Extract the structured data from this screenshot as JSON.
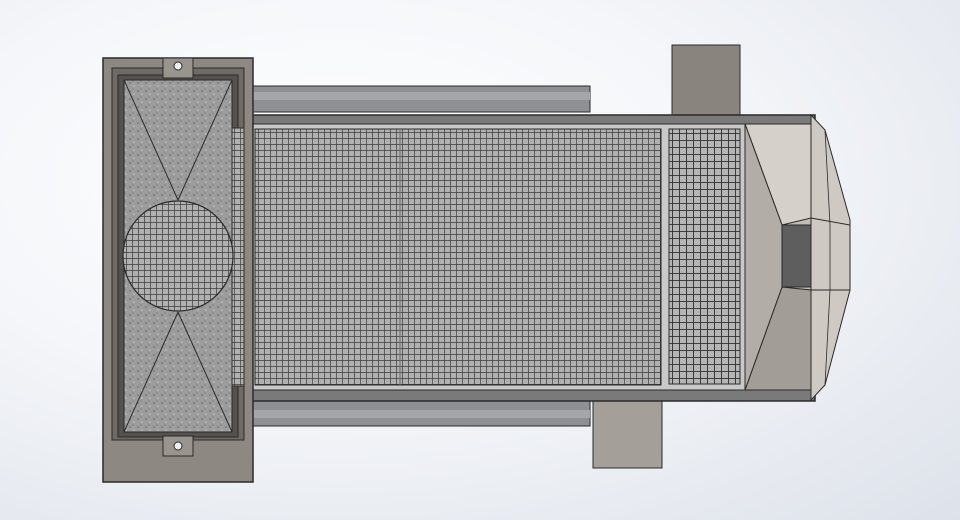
{
  "colors": {
    "frame": "#8d8882",
    "frame_inner": "#6f6a66",
    "filter": "#9a9a9a",
    "rail": "#8e9093",
    "body": "#6b6b6b",
    "mesh_bg": "#a9a9a9",
    "mesh_line": "#3e3e3e",
    "hopper": "#b9b2ab",
    "tab": "#8a847f",
    "outline": "#2a2a2a"
  }
}
